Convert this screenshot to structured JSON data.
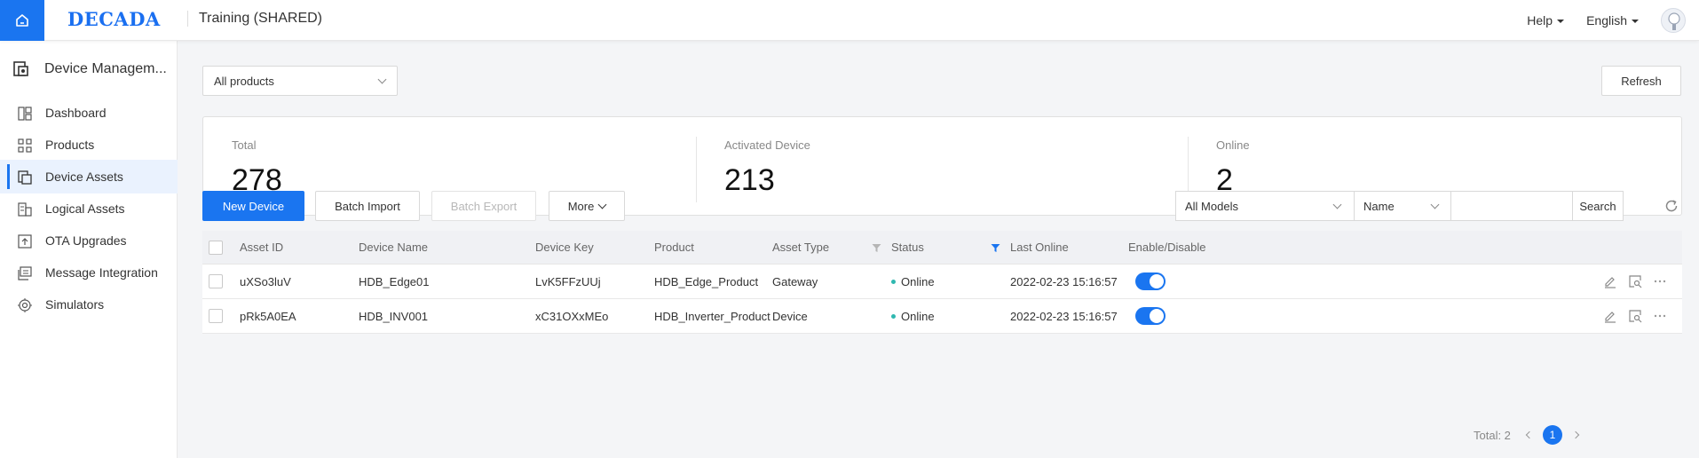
{
  "header": {
    "logo": "DECADA",
    "title": "Training (SHARED)",
    "help_label": "Help",
    "language_label": "English"
  },
  "sidebar": {
    "module_title": "Device Managem...",
    "items": [
      {
        "label": "Dashboard",
        "icon": "dashboard-icon"
      },
      {
        "label": "Products",
        "icon": "products-icon"
      },
      {
        "label": "Device Assets",
        "icon": "device-assets-icon",
        "active": true
      },
      {
        "label": "Logical Assets",
        "icon": "logical-assets-icon"
      },
      {
        "label": "OTA Upgrades",
        "icon": "ota-icon"
      },
      {
        "label": "Message Integration",
        "icon": "message-icon"
      },
      {
        "label": "Simulators",
        "icon": "simulator-icon"
      }
    ]
  },
  "toolbar": {
    "product_filter": "All products",
    "refresh_label": "Refresh"
  },
  "stats": {
    "total_label": "Total",
    "total_value": "278",
    "activated_label": "Activated Device",
    "activated_value": "213",
    "online_label": "Online",
    "online_value": "2"
  },
  "actions": {
    "new_device": "New Device",
    "batch_import": "Batch Import",
    "batch_export": "Batch Export",
    "more": "More"
  },
  "filters": {
    "model_select": "All Models",
    "field_select": "Name",
    "search_placeholder": "",
    "search_label": "Search"
  },
  "table": {
    "columns": [
      "Asset ID",
      "Device Name",
      "Device Key",
      "Product",
      "Asset Type",
      "Status",
      "Last Online",
      "Enable/Disable"
    ],
    "rows": [
      {
        "asset_id": "uXSo3luV",
        "device_name": "HDB_Edge01",
        "device_key": "LvK5FFzUUj",
        "product": "HDB_Edge_Product",
        "asset_type": "Gateway",
        "status": "Online",
        "last_online": "2022-02-23 15:16:57",
        "enabled": true
      },
      {
        "asset_id": "pRk5A0EA",
        "device_name": "HDB_INV001",
        "device_key": "xC31OXxMEo",
        "product": "HDB_Inverter_Product",
        "asset_type": "Device",
        "status": "Online",
        "last_online": "2022-02-23 15:16:57",
        "enabled": true
      }
    ]
  },
  "pagination": {
    "total_text": "Total: 2",
    "current_page": "1"
  },
  "colors": {
    "primary": "#1a75f0",
    "online_dot": "#2fb8b0"
  }
}
